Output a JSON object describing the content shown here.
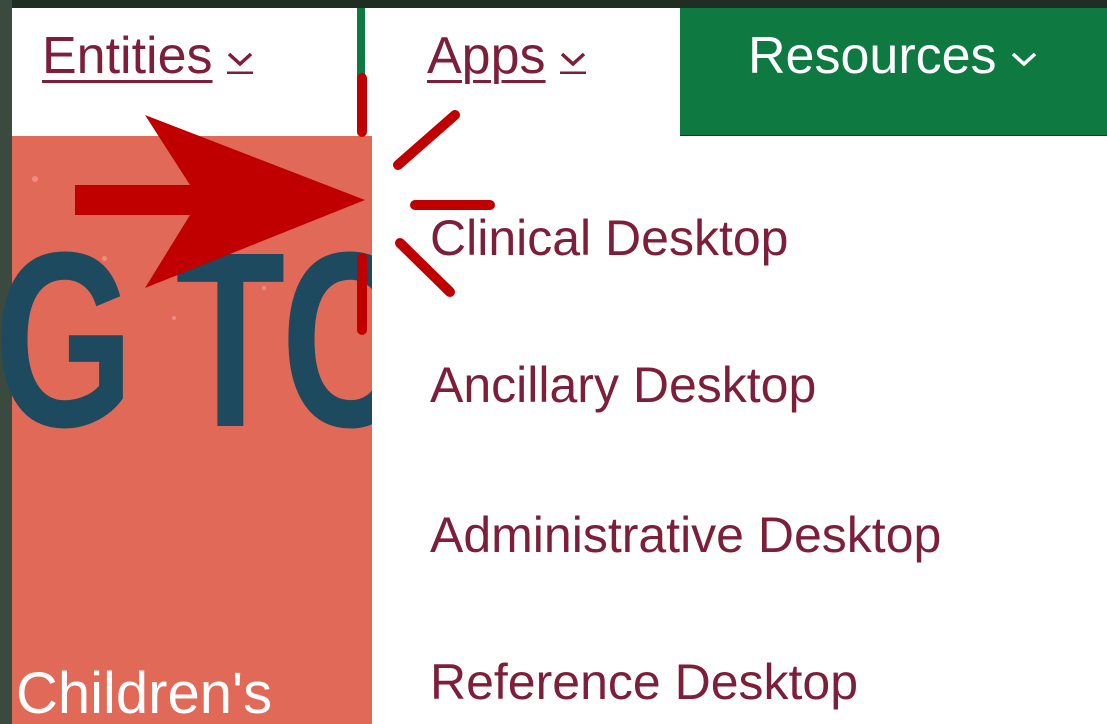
{
  "nav": {
    "entities": {
      "label": "Entities",
      "icon": "chevron-down-icon"
    },
    "apps": {
      "label": "Apps",
      "icon": "chevron-down-icon"
    },
    "resources": {
      "label": "Resources",
      "icon": "chevron-down-icon"
    }
  },
  "apps_menu": {
    "items": [
      {
        "label": "Clinical Desktop"
      },
      {
        "label": "Ancillary Desktop"
      },
      {
        "label": "Administrative Desktop"
      },
      {
        "label": "Reference Desktop"
      }
    ]
  },
  "hero": {
    "headline_fragment": "G TC",
    "caption_fragment": "Children's"
  },
  "annotation": {
    "arrow_icon": "red-arrow-icon",
    "highlight_icon": "red-burst-icon"
  },
  "colors": {
    "brand_green": "#0e7a41",
    "link_maroon": "#7d1e3a",
    "hero_coral": "#e06a57",
    "hero_navy": "#1d4a5e",
    "annotation_red": "#c00000"
  }
}
